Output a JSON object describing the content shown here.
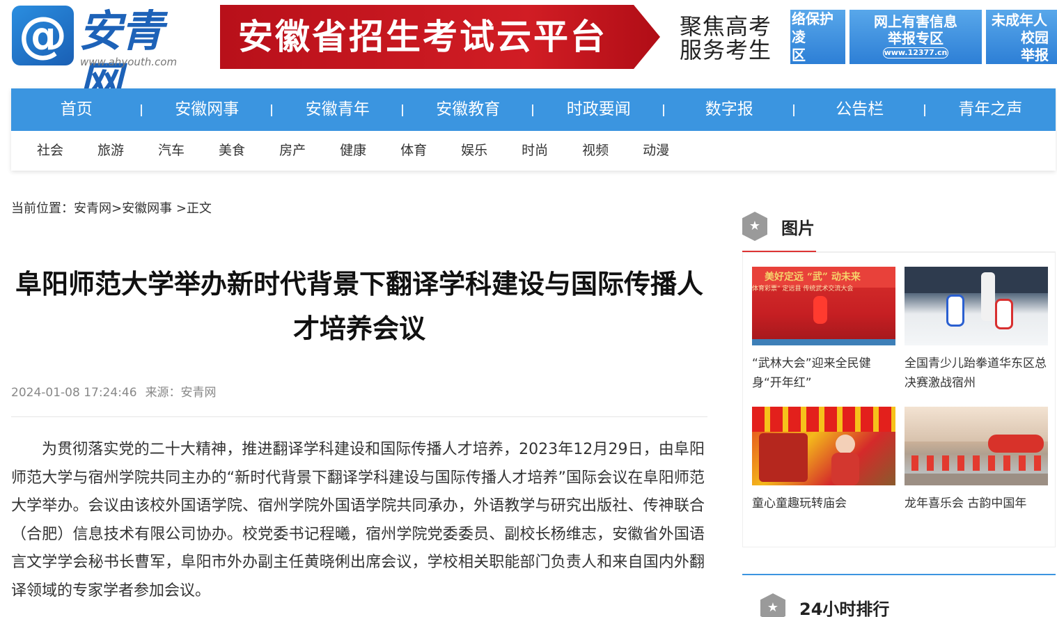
{
  "header": {
    "logo_at": "@",
    "logo_name": "安青网",
    "logo_url": "www.ahyouth.com",
    "banner_title": "安徽省招生考试云平台",
    "banner_sub": "聚焦高考 服务考生",
    "ad1_lines": [
      "络保护",
      "凌",
      "区"
    ],
    "ad2_lines": [
      "网上有害信息",
      "举报专区"
    ],
    "ad2_url": "www.12377.cn",
    "ad3_lines": [
      "未成年人",
      "校园",
      "举报"
    ]
  },
  "nav": {
    "main": [
      "首页",
      "安徽网事",
      "安徽青年",
      "安徽教育",
      "时政要闻",
      "数字报",
      "公告栏",
      "青年之声"
    ],
    "sub": [
      "社会",
      "旅游",
      "汽车",
      "美食",
      "房产",
      "健康",
      "体育",
      "娱乐",
      "时尚",
      "视频",
      "动漫"
    ]
  },
  "breadcrumb": {
    "prefix": "当前位置：",
    "home": "安青网",
    "sep1": ">",
    "section": "安徽网事",
    "sep2": " >",
    "current": "正文"
  },
  "article": {
    "title": "阜阳师范大学举办新时代背景下翻译学科建设与国际传播人才培养会议",
    "datetime": "2024-01-08 17:24:46",
    "source": "来源：安青网",
    "body": "为贯彻落实党的二十大精神，推进翻译学科建设和国际传播人才培养，2023年12月29日，由阜阳师范大学与宿州学院共同主办的“新时代背景下翻译学科建设与国际传播人才培养”国际会议在阜阳师范大学举办。会议由该校外国语学院、宿州学院外国语学院共同承办，外语教学与研究出版社、传神联合（合肥）信息技术有限公司协办。校党委书记程曦，宿州学院党委委员、副校长杨维志，安徽省外国语言文学学会秘书长曹军，阜阳市外办副主任黄晓俐出席会议，学校相关职能部门负责人和来自国内外翻译领域的专家学者参加会议。"
  },
  "sidebar": {
    "pictures_title": "图片",
    "star": "★",
    "thumb1_banner": "美好定远 “武” 动未来",
    "thumb1_sub": "体育彩票” 定远县 传统武术交流大会",
    "pictures": [
      {
        "caption": "“武林大会”迎来全民健身“开年红”"
      },
      {
        "caption": "全国青少儿跆拳道华东区总决赛激战宿州"
      },
      {
        "caption": "童心童趣玩转庙会"
      },
      {
        "caption": "龙年喜乐会 古韵中国年"
      }
    ],
    "ranking_title": "24小时排行"
  },
  "colors": {
    "nav_blue": "#3b95e0",
    "banner_red": "#d11d24",
    "accent_red": "#dd3333"
  }
}
